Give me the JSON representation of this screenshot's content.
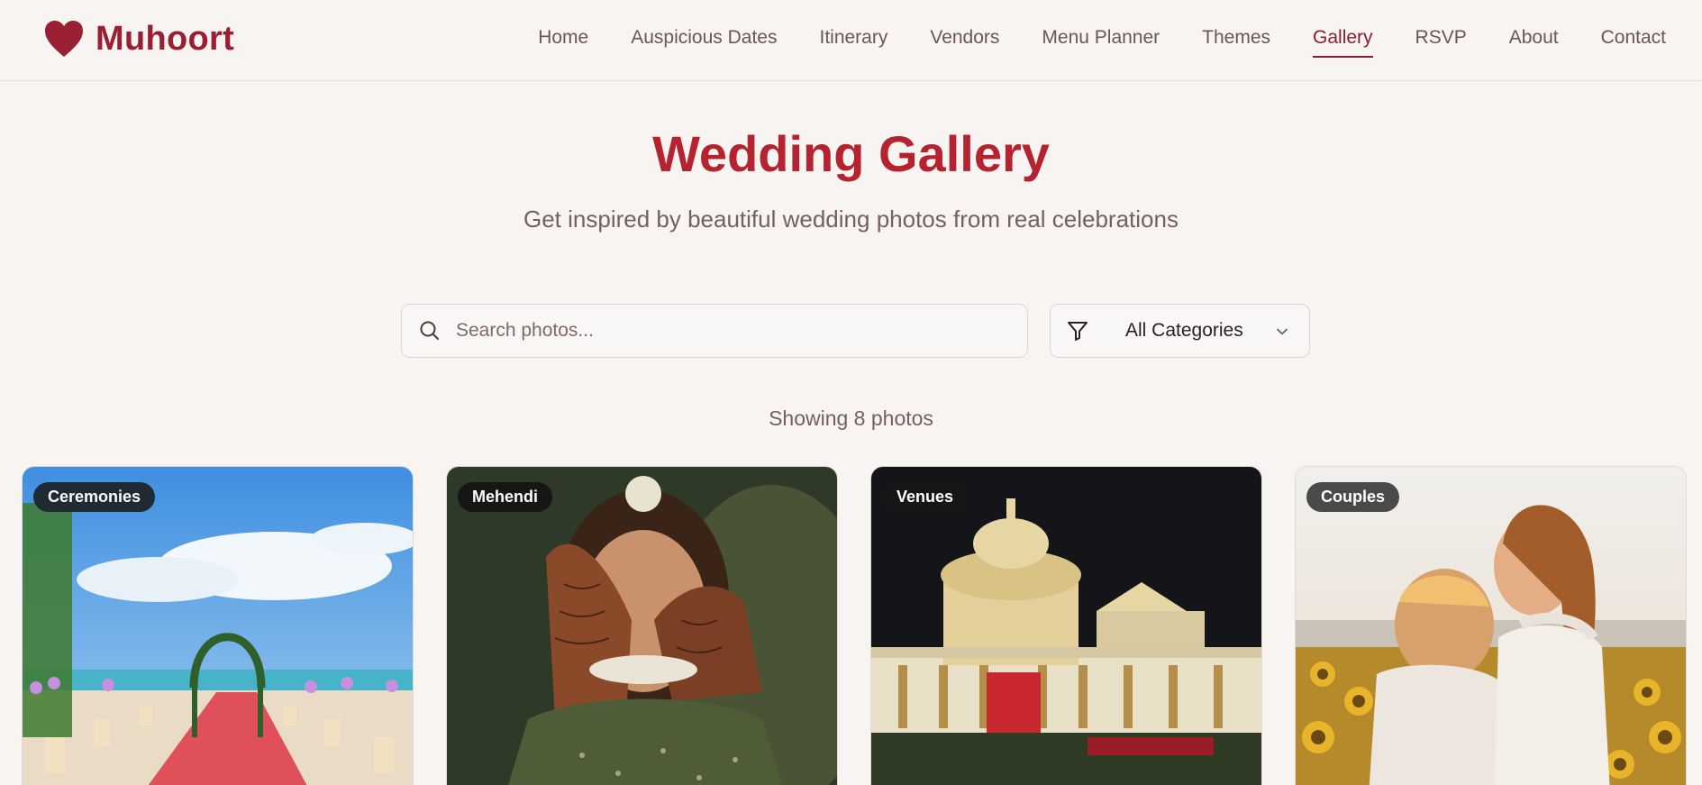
{
  "brand": {
    "name": "Muhoort",
    "icon": "heart-icon",
    "color": "#9b1f33"
  },
  "nav": {
    "items": [
      {
        "label": "Home"
      },
      {
        "label": "Auspicious Dates"
      },
      {
        "label": "Itinerary"
      },
      {
        "label": "Vendors"
      },
      {
        "label": "Menu Planner"
      },
      {
        "label": "Themes"
      },
      {
        "label": "Gallery",
        "active": true
      },
      {
        "label": "RSVP"
      },
      {
        "label": "About"
      },
      {
        "label": "Contact"
      }
    ]
  },
  "hero": {
    "title": "Wedding Gallery",
    "subtitle": "Get inspired by beautiful wedding photos from real celebrations"
  },
  "filters": {
    "search_placeholder": "Search photos...",
    "search_value": "",
    "category_selected": "All Categories"
  },
  "results": {
    "count_text": "Showing 8 photos"
  },
  "gallery": [
    {
      "category": "Ceremonies",
      "scene": "beach ceremony with floral arch and red aisle"
    },
    {
      "category": "Mehendi",
      "scene": "bride with henna hands covering face"
    },
    {
      "category": "Venues",
      "scene": "illuminated palace venue at night"
    },
    {
      "category": "Couples",
      "scene": "couple embracing in sunflower field"
    }
  ],
  "colors": {
    "accent": "#b4232f",
    "nav_active": "#8e1c30",
    "background": "#f7f4f2"
  }
}
